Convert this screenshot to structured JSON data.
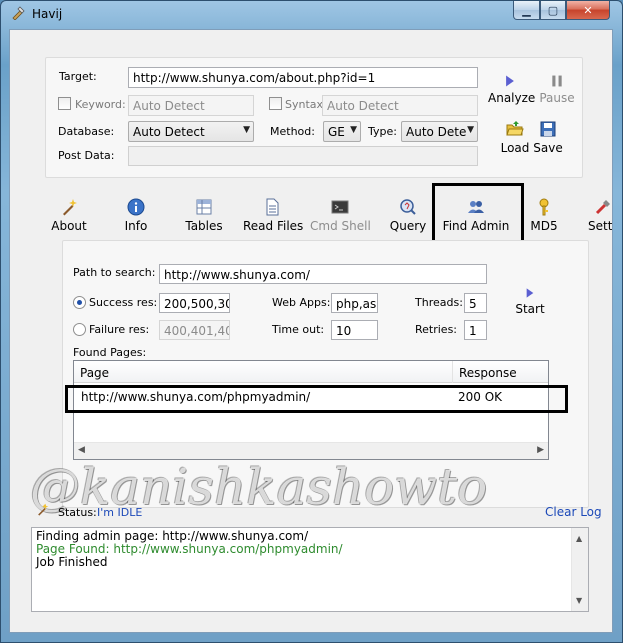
{
  "window": {
    "title": "Havij",
    "min_glyph": "▁",
    "max_glyph": "▢",
    "close_glyph": "✕"
  },
  "request": {
    "target_label": "Target:",
    "target_value": "http://www.shunya.com/about.php?id=1",
    "keyword_label": "Keyword:",
    "keyword_placeholder": "Auto Detect",
    "syntax_label": "Syntax:",
    "syntax_placeholder": "Auto Detect",
    "database_label": "Database:",
    "database_value": "Auto Detect",
    "method_label": "Method:",
    "method_value": "GE",
    "type_label": "Type:",
    "type_value": "Auto Dete",
    "postdata_label": "Post Data:",
    "postdata_value": ""
  },
  "actions": {
    "analyze": "Analyze",
    "pause": "Pause",
    "load": "Load",
    "save": "Save"
  },
  "toolbar": [
    {
      "label": "About",
      "icon": "wand-icon",
      "enabled": true
    },
    {
      "label": "Info",
      "icon": "info-icon",
      "enabled": true
    },
    {
      "label": "Tables",
      "icon": "table-icon",
      "enabled": true
    },
    {
      "label": "Read Files",
      "icon": "file-icon",
      "enabled": true
    },
    {
      "label": "Cmd Shell",
      "icon": "terminal-icon",
      "enabled": false
    },
    {
      "label": "Query",
      "icon": "query-icon",
      "enabled": true
    },
    {
      "label": "Find Admin",
      "icon": "users-icon",
      "enabled": true
    },
    {
      "label": "MD5",
      "icon": "key-icon",
      "enabled": true
    },
    {
      "label": "Setti",
      "icon": "settings-icon",
      "enabled": true
    }
  ],
  "find_admin": {
    "path_label": "Path to search:",
    "path_value": "http://www.shunya.com/",
    "success_label": "Success res:",
    "success_value": "200,500,30",
    "failure_label": "Failure res:",
    "failure_value": "400,401,40",
    "webapps_label": "Web Apps:",
    "webapps_value": "php,asp",
    "timeout_label": "Time out:",
    "timeout_value": "10",
    "threads_label": "Threads:",
    "threads_value": "5",
    "retries_label": "Retries:",
    "retries_value": "1",
    "start_label": "Start",
    "found_label": "Found Pages:",
    "columns": [
      "Page",
      "Response"
    ],
    "rows": [
      {
        "page": "http://www.shunya.com/phpmyadmin/",
        "response": "200 OK"
      }
    ]
  },
  "status": {
    "label": "Status:",
    "value": "I'm IDLE",
    "clear_log": "Clear Log",
    "log": [
      {
        "text": "Finding admin page: http://www.shunya.com/",
        "color": "#000000"
      },
      {
        "text": "Page Found: http://www.shunya.com/phpmyadmin/",
        "color": "#2e8b2e"
      },
      {
        "text": "Job Finished",
        "color": "#000000"
      }
    ]
  },
  "watermark": "@kanishkashowto",
  "colors": {
    "accent": "#1c49b8",
    "found_green": "#2e8b2e"
  }
}
